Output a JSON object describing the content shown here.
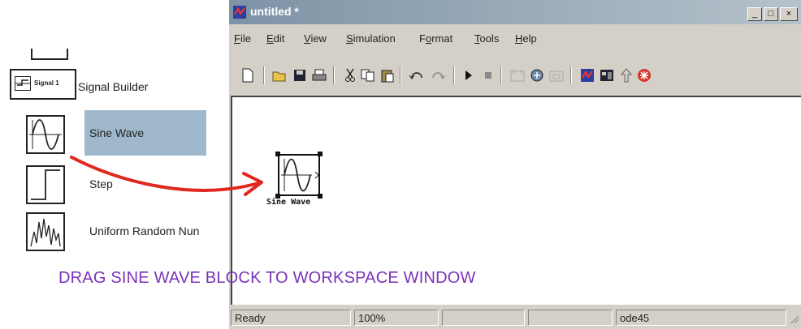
{
  "library": {
    "items": [
      {
        "label": "Signal Builder",
        "icon": "signal-builder-icon",
        "block_text": "Signal 1"
      },
      {
        "label": "Sine Wave",
        "icon": "sine-wave-icon",
        "selected": true
      },
      {
        "label": "Step",
        "icon": "step-icon"
      },
      {
        "label": "Uniform Random Nun",
        "icon": "random-number-icon"
      }
    ]
  },
  "window": {
    "title": "untitled *",
    "controls": {
      "minimize": "_",
      "maximize": "□",
      "close": "×"
    },
    "menus": [
      {
        "label": "File",
        "mnemonic": "F"
      },
      {
        "label": "Edit",
        "mnemonic": "E"
      },
      {
        "label": "View",
        "mnemonic": "V"
      },
      {
        "label": "Simulation",
        "mnemonic": "S"
      },
      {
        "label": "Format",
        "mnemonic": "o"
      },
      {
        "label": "Tools",
        "mnemonic": "T"
      },
      {
        "label": "Help",
        "mnemonic": "H"
      }
    ],
    "toolbar": [
      "new-icon",
      "open-icon",
      "save-icon",
      "print-icon",
      "cut-icon",
      "copy-icon",
      "paste-icon",
      "undo-icon",
      "redo-icon",
      "start-icon",
      "stop-icon",
      "build-icon",
      "update-icon",
      "build-sub-icon",
      "library-browser-icon",
      "model-explorer-icon",
      "up-icon",
      "debug-icon"
    ],
    "model_block": {
      "label": "Sine Wave",
      "icon": "sine-wave-icon"
    },
    "status": {
      "state": "Ready",
      "zoom": "100%",
      "solver": "ode45"
    }
  },
  "instruction": "DRAG SINE WAVE BLOCK TO WORKSPACE WINDOW",
  "colors": {
    "caption": "#7a32b8",
    "arrow": "#e0281e",
    "selection": "#9fb8cb",
    "titlebar": "#7d93a6"
  }
}
